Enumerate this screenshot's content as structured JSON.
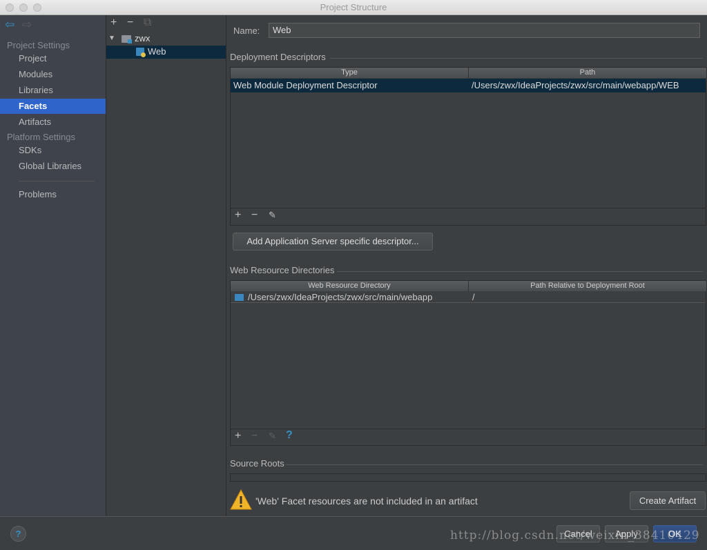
{
  "window": {
    "title": "Project Structure"
  },
  "sidebar": {
    "project_settings": "Project Settings",
    "items": [
      {
        "label": "Project"
      },
      {
        "label": "Modules"
      },
      {
        "label": "Libraries"
      },
      {
        "label": "Facets",
        "selected": true
      },
      {
        "label": "Artifacts"
      }
    ],
    "platform_settings": "Platform Settings",
    "platform_items": [
      {
        "label": "SDKs"
      },
      {
        "label": "Global Libraries"
      }
    ],
    "problems": "Problems"
  },
  "tree": {
    "root": "zwx",
    "child": "Web"
  },
  "main": {
    "name_label": "Name:",
    "name_value": "Web",
    "deployment": {
      "title": "Deployment Descriptors",
      "columns": [
        "Type",
        "Path"
      ],
      "rows": [
        [
          "Web Module Deployment Descriptor",
          "/Users/zwx/IdeaProjects/zwx/src/main/webapp/WEB"
        ]
      ],
      "add_button": "Add Application Server specific descriptor..."
    },
    "resources": {
      "title": "Web Resource Directories",
      "columns": [
        "Web Resource Directory",
        "Path Relative to Deployment Root"
      ],
      "rows": [
        [
          "/Users/zwx/IdeaProjects/zwx/src/main/webapp",
          "/"
        ]
      ]
    },
    "source_roots": "Source Roots",
    "warning": "'Web' Facet resources are not included in an artifact",
    "create_artifact": "Create Artifact"
  },
  "footer": {
    "cancel": "Cancel",
    "apply": "Apply",
    "ok": "OK"
  },
  "watermark": "http://blog.csdn.net/weixin_38410429",
  "colors": {
    "selection": "#2f65ca",
    "table_selection": "#0d293e",
    "accent": "#3592c4"
  }
}
